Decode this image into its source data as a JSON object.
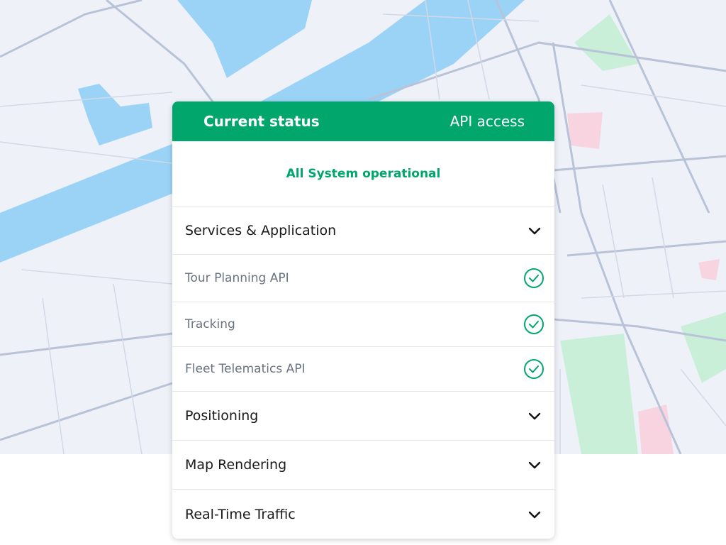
{
  "header": {
    "title": "Current status",
    "api_link": "API access"
  },
  "status": {
    "message": "All System operational"
  },
  "sections": [
    {
      "label": "Services & Application",
      "expanded": true,
      "items": [
        {
          "label": "Tour Planning API",
          "state": "operational"
        },
        {
          "label": "Tracking",
          "state": "operational"
        },
        {
          "label": "Fleet Telematics API",
          "state": "operational"
        }
      ]
    },
    {
      "label": "Positioning",
      "expanded": false
    },
    {
      "label": "Map Rendering",
      "expanded": false
    },
    {
      "label": "Real-Time Traffic",
      "expanded": false
    }
  ],
  "colors": {
    "accent": "#00a66b",
    "water": "#9bd3f7",
    "park": "#c9efd9",
    "road": "#b8c3d8"
  },
  "icons": {
    "expand": "chevron-down-icon",
    "ok": "check-circle-icon"
  }
}
